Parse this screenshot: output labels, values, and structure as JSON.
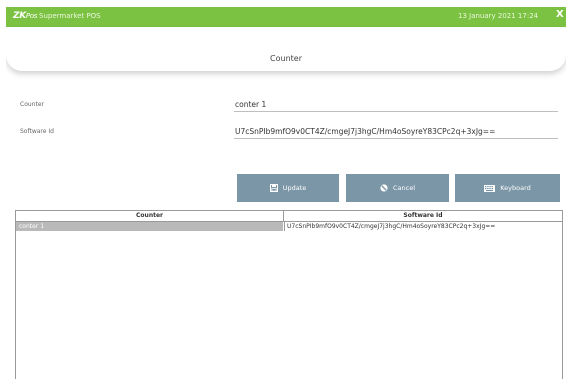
{
  "titlebar": {
    "logo_main": "ZK",
    "logo_sub": "Pos",
    "app_name": "Supermarket POS",
    "datetime": "13 January 2021 17:24",
    "close_label": "X"
  },
  "page": {
    "title": "Counter"
  },
  "form": {
    "counter_label": "Counter",
    "counter_value": "conter 1",
    "software_id_label": "Software Id",
    "software_id_value": "U7cSnPIb9mfO9v0CT4Z/cmgeJ7j3hgC/Hm4oSoyreY83CPc2q+3xJg=="
  },
  "buttons": {
    "update_label": "Update",
    "cancel_label": "Cancel",
    "keyboard_label": "Keyboard"
  },
  "table": {
    "columns": [
      "Counter",
      "Software Id"
    ],
    "rows": [
      {
        "counter": "conter 1",
        "software_id": "U7cSnPIb9mfO9v0CT4Z/cmgeJ7j3hgC/Hm4oSoyreY83CPc2q+3xJg=="
      }
    ]
  },
  "colors": {
    "titlebar": "#7cc242",
    "button": "#7b96a7",
    "selected_row": "#b9b9b9"
  }
}
